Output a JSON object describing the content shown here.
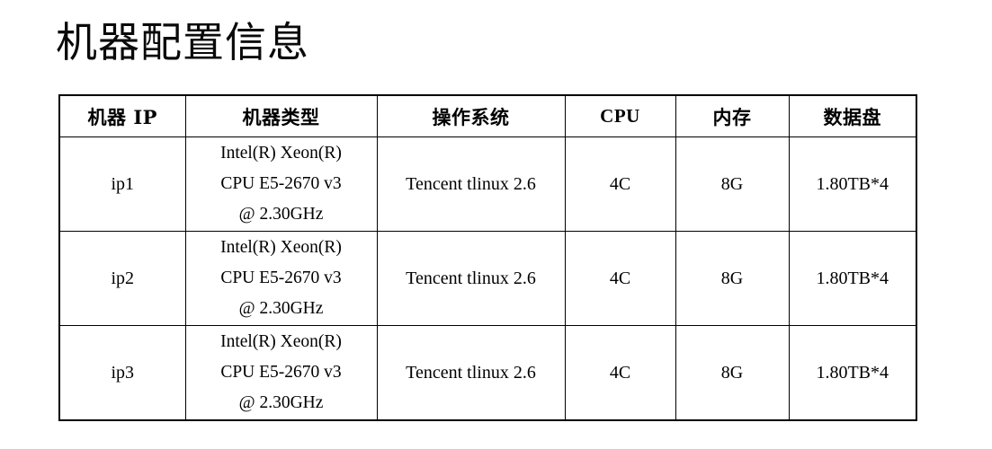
{
  "document": {
    "title": "机器配置信息"
  },
  "table": {
    "headers": [
      {
        "label": "机器 IP",
        "kind": "cjk"
      },
      {
        "label": "机器类型",
        "kind": "cjk"
      },
      {
        "label": "操作系统",
        "kind": "cjk"
      },
      {
        "label": "CPU",
        "kind": "latin"
      },
      {
        "label": "内存",
        "kind": "cjk"
      },
      {
        "label": "数据盘",
        "kind": "cjk"
      }
    ],
    "rows": [
      {
        "ip": "ip1",
        "machine_type_lines": [
          "Intel(R) Xeon(R)",
          "CPU E5-2670 v3",
          "@ 2.30GHz"
        ],
        "machine_type": "Intel(R) Xeon(R) CPU E5-2670 v3 @ 2.30GHz",
        "os": "Tencent tlinux 2.6",
        "cpu": "4C",
        "memory": "8G",
        "data_disk": "1.80TB*4"
      },
      {
        "ip": "ip2",
        "machine_type_lines": [
          "Intel(R) Xeon(R)",
          "CPU E5-2670 v3",
          "@ 2.30GHz"
        ],
        "machine_type": "Intel(R) Xeon(R) CPU E5-2670 v3 @ 2.30GHz",
        "os": "Tencent tlinux 2.6",
        "cpu": "4C",
        "memory": "8G",
        "data_disk": "1.80TB*4"
      },
      {
        "ip": "ip3",
        "machine_type_lines": [
          "Intel(R) Xeon(R)",
          "CPU E5-2670 v3",
          "@ 2.30GHz"
        ],
        "machine_type": "Intel(R) Xeon(R) CPU E5-2670 v3 @ 2.30GHz",
        "os": "Tencent tlinux 2.6",
        "cpu": "4C",
        "memory": "8G",
        "data_disk": "1.80TB*4"
      }
    ]
  },
  "colors": {
    "background": "#ffffff",
    "text": "#000000",
    "border": "#000000"
  }
}
